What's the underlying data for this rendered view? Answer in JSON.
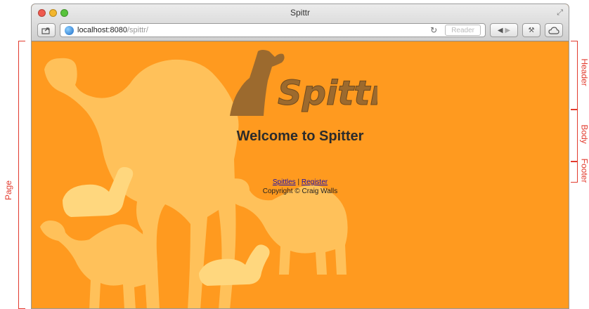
{
  "window": {
    "title": "Spittr",
    "url_host": "localhost:8080",
    "url_path": "/spittr/",
    "reader_label": "Reader"
  },
  "page": {
    "logo_text": "Spittr",
    "welcome": "Welcome to Spitter",
    "links": [
      {
        "label": "Spittles"
      },
      {
        "label": "Register"
      }
    ],
    "link_separator": "|",
    "copyright": "Copyright © Craig Walls"
  },
  "annotations": {
    "page": "Page",
    "header": "Header",
    "body": "Body",
    "footer": "Footer"
  },
  "colors": {
    "background": "#ff9a1f",
    "camel": "#ffc15a",
    "camel_light": "#ffd77e",
    "logo_brown": "#9c6a2e",
    "annotation": "#e23b2e"
  }
}
